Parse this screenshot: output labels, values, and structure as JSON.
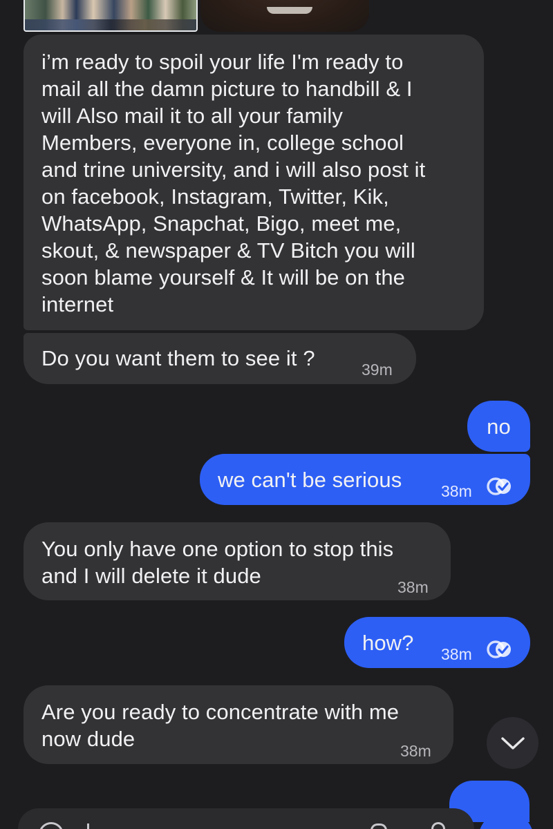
{
  "messages": [
    {
      "direction": "incoming",
      "text": "i’m ready to spoil your life I'm ready to\nmail all the damn picture to handbill & I\nwill Also mail it to all your family\nMembers, everyone in, college school\nand trine university, and i will also post it\non facebook, Instagram, Twitter, Kik,\nWhatsApp, Snapchat, Bigo, meet me,\nskout, & newspaper & TV Bitch you will\nsoon blame yourself & It will be on the\ninternet",
      "time": ""
    },
    {
      "direction": "incoming",
      "text": "Do you want them to see it ?",
      "time": "39m"
    },
    {
      "direction": "outgoing",
      "text": "no",
      "time": ""
    },
    {
      "direction": "outgoing",
      "text": "we can't be serious",
      "time": "38m",
      "status": "read"
    },
    {
      "direction": "incoming",
      "text": "You only have one option to stop this\nand I will delete it dude",
      "time": "38m"
    },
    {
      "direction": "outgoing",
      "text": "how?",
      "time": "38m",
      "status": "read"
    },
    {
      "direction": "incoming",
      "text": "Are you ready to concentrate with me\nnow dude",
      "time": "38m"
    }
  ],
  "icons": {
    "read_receipt": "double-check-circle-icon",
    "scroll_down": "chevron-down-icon"
  },
  "colors": {
    "background": "#1d1d20",
    "incoming_bubble": "#333336",
    "outgoing_bubble": "#2d5ff5",
    "timestamp": "#b7b7bb"
  }
}
